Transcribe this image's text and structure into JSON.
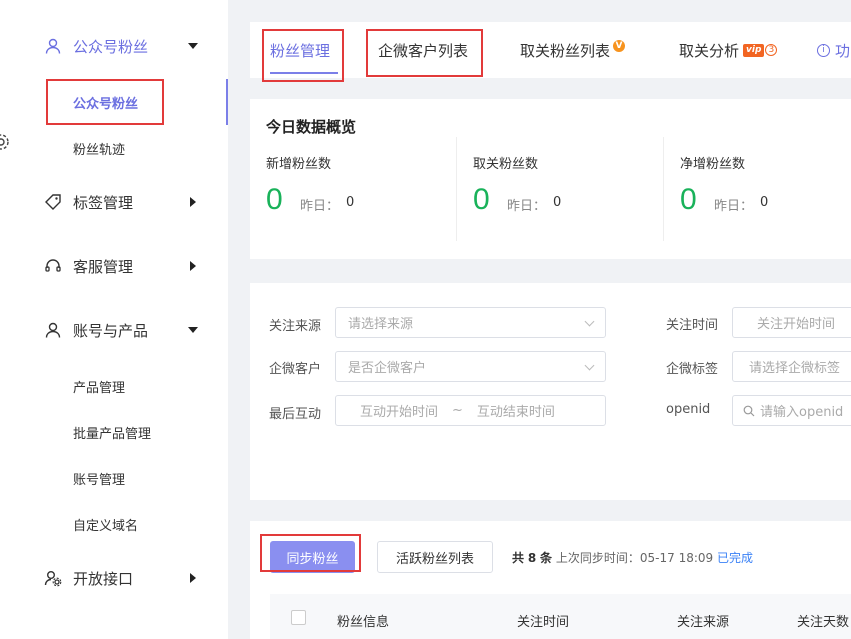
{
  "sidebar": {
    "groups": [
      {
        "label": "公众号粉丝"
      },
      {
        "label": "标签管理"
      },
      {
        "label": "客服管理"
      },
      {
        "label": "账号与产品"
      },
      {
        "label": "开放接口"
      }
    ],
    "subs": [
      {
        "label": "公众号粉丝"
      },
      {
        "label": "粉丝轨迹"
      },
      {
        "label": "产品管理"
      },
      {
        "label": "批量产品管理"
      },
      {
        "label": "账号管理"
      },
      {
        "label": "自定义域名"
      }
    ]
  },
  "tabs": [
    {
      "label": "粉丝管理"
    },
    {
      "label": "企微客户列表"
    },
    {
      "label": "取关粉丝列表",
      "badge": "V"
    },
    {
      "label": "取关分析",
      "badge": "vip",
      "badge_num": "3"
    },
    {
      "label": "功"
    }
  ],
  "overview": {
    "title": "今日数据概览",
    "stats": [
      {
        "label": "新增粉丝数",
        "value": "0",
        "yesterday_label": "昨日：",
        "yesterday_value": "0"
      },
      {
        "label": "取关粉丝数",
        "value": "0",
        "yesterday_label": "昨日：",
        "yesterday_value": "0"
      },
      {
        "label": "净增粉丝数",
        "value": "0",
        "yesterday_label": "昨日：",
        "yesterday_value": "0"
      }
    ]
  },
  "filters": {
    "source_label": "关注来源",
    "source_placeholder": "请选择来源",
    "follow_time_label": "关注时间",
    "follow_start_placeholder": "关注开始时间",
    "wecom_label": "企微客户",
    "wecom_placeholder": "是否企微客户",
    "wecom_tag_label": "企微标签",
    "wecom_tag_placeholder": "请选择企微标签",
    "last_interact_label": "最后互动",
    "interact_start": "互动开始时间",
    "range_sep": "~",
    "interact_end": "互动结束时间",
    "openid_label": "openid",
    "openid_placeholder": "请输入openid"
  },
  "actions": {
    "sync_button": "同步粉丝",
    "active_list_button": "活跃粉丝列表",
    "total_prefix": "共",
    "total_count": "8",
    "total_suffix": "条",
    "last_sync_label": "上次同步时间：",
    "last_sync_time": "05-17 18:09",
    "sync_status": "已完成"
  },
  "table": {
    "headers": [
      "粉丝信息",
      "关注时间",
      "关注来源",
      "关注天数"
    ]
  },
  "colors": {
    "accent": "#6b6fe0",
    "green": "#19b25a",
    "annotation_red": "#e23a3a"
  }
}
